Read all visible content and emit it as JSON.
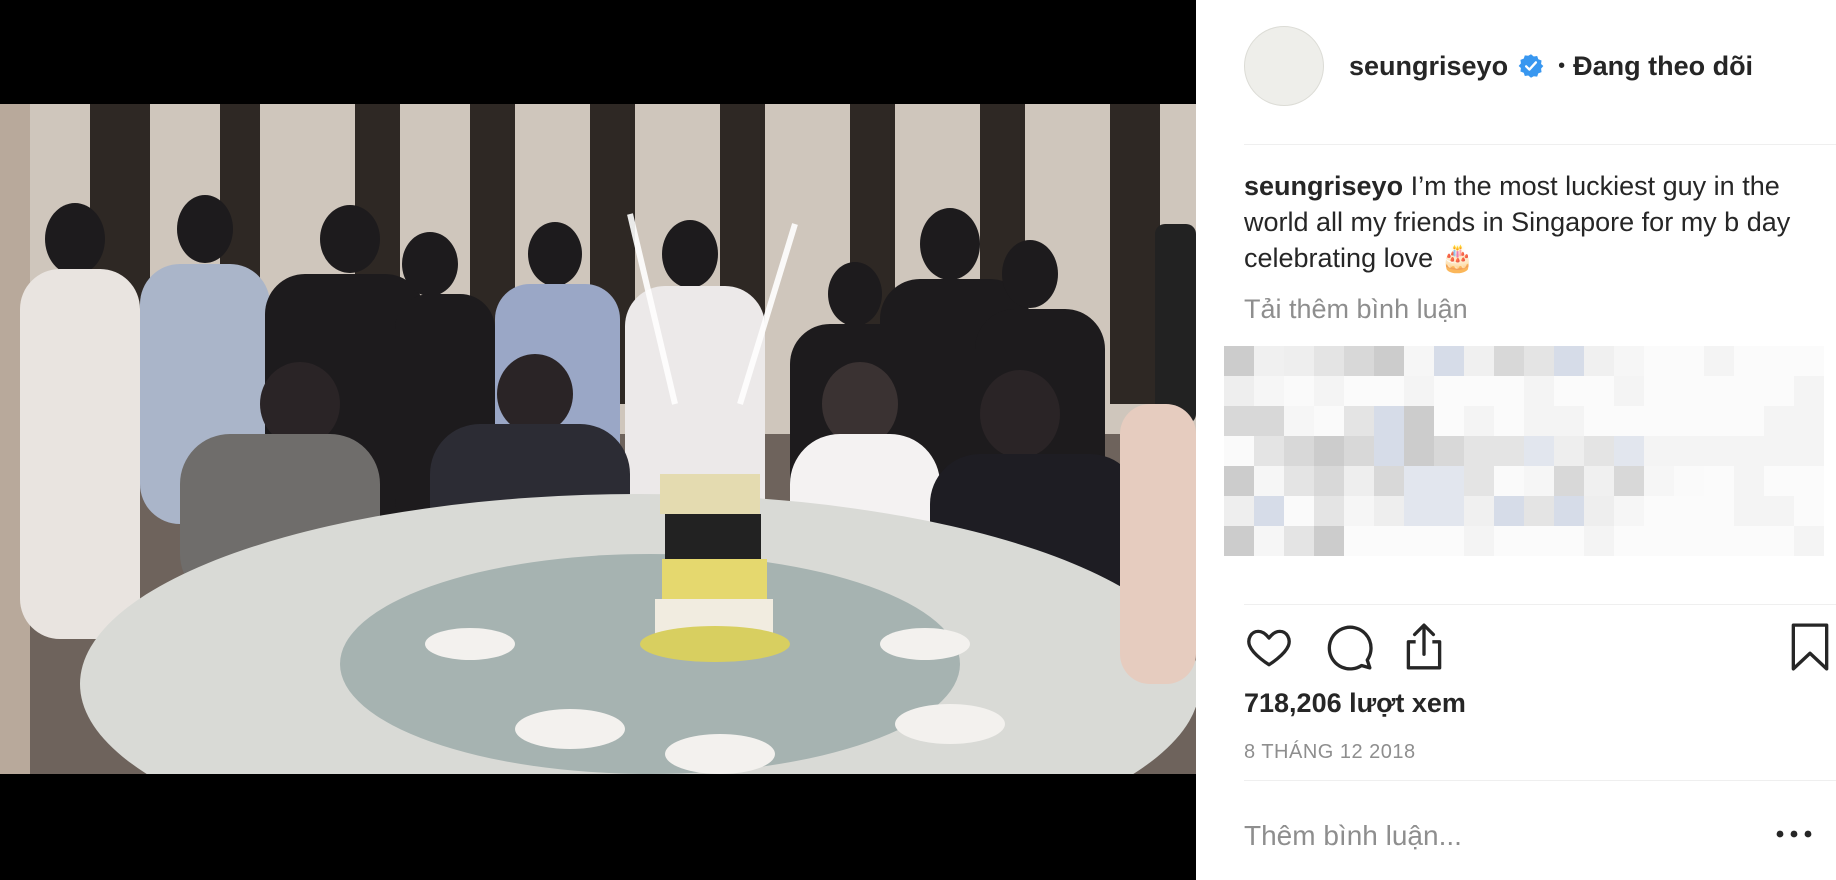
{
  "post": {
    "username": "seungriseyo",
    "separator": "•",
    "follow_status": "Đang theo dõi",
    "caption": "I’m the most luckiest guy in the world all my friends in Singapore for my b day celebrating love 🎂",
    "load_more_comments": "Tải thêm bình luận",
    "views": "718,206 lượt xem",
    "date": "8 THÁNG 12 2018",
    "comment_placeholder": "Thêm bình luận..."
  },
  "icons": {
    "like": "heart-icon",
    "comment": "comment-bubble-icon",
    "share": "share-icon",
    "save": "bookmark-icon",
    "verified": "verified-badge-icon",
    "more": "more-options-icon"
  },
  "colors": {
    "text": "#262626",
    "muted": "#8e8e8e",
    "verified": "#3897f0",
    "divider": "#efefef"
  }
}
